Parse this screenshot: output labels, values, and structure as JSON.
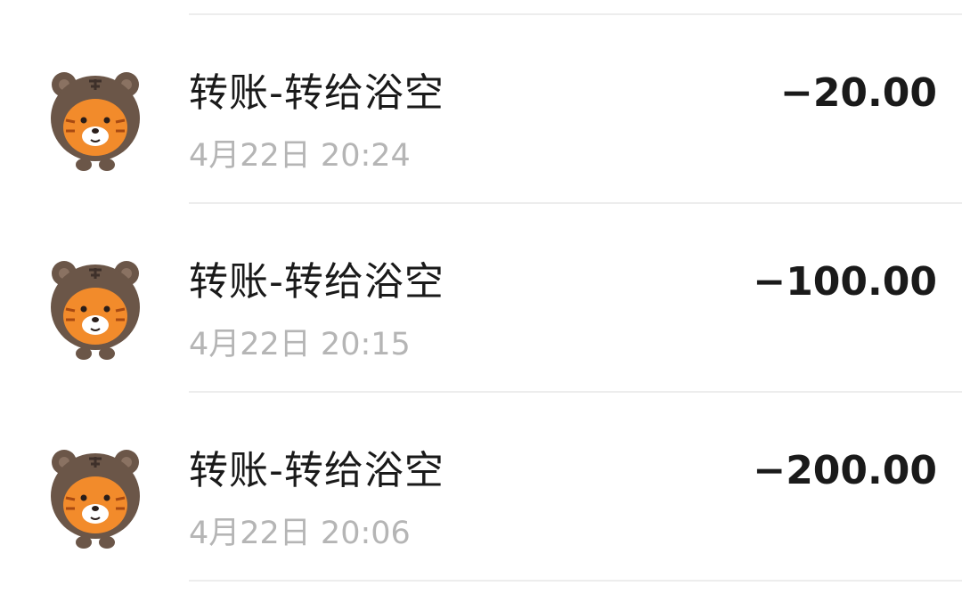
{
  "transactions": [
    {
      "title": "转账-转给浴空",
      "time": "4月22日 20:24",
      "amount": "−20.00",
      "avatar_icon": "tiger-avatar-icon"
    },
    {
      "title": "转账-转给浴空",
      "time": "4月22日 20:15",
      "amount": "−100.00",
      "avatar_icon": "tiger-avatar-icon"
    },
    {
      "title": "转账-转给浴空",
      "time": "4月22日 20:06",
      "amount": "−200.00",
      "avatar_icon": "tiger-avatar-icon"
    }
  ],
  "colors": {
    "title": "#1a1a1a",
    "time": "#b5b5b5",
    "amount": "#1a1a1a",
    "divider": "#ededed",
    "avatar_hood": "#6b5648",
    "avatar_face": "#f28b2b"
  }
}
